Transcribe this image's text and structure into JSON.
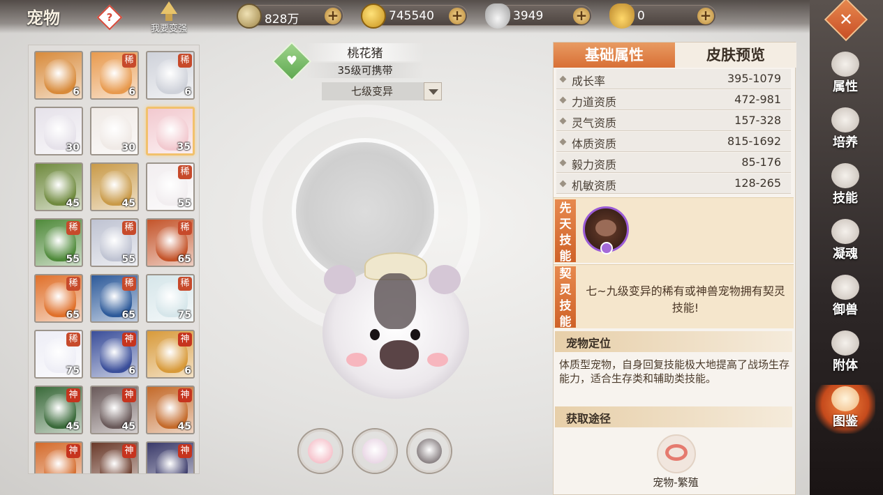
{
  "header": {
    "title": "宠物",
    "help_icon": "?",
    "stronger_label": "我要变强"
  },
  "currencies": [
    {
      "icon": "copper-coin-icon",
      "value": "828万"
    },
    {
      "icon": "gold-coin-icon",
      "value": "745540"
    },
    {
      "icon": "silver-ingot-icon",
      "value": "3949"
    },
    {
      "icon": "gold-ingot-icon",
      "value": "0"
    }
  ],
  "pet_grid": [
    {
      "color": "#d88a3a",
      "tag": "",
      "level": "6"
    },
    {
      "color": "#e89a4e",
      "tag": "稀",
      "level": "6"
    },
    {
      "color": "#cfd2da",
      "tag": "稀",
      "level": "6"
    },
    {
      "color": "#e6e2ea",
      "tag": "",
      "level": "30"
    },
    {
      "color": "#f0eae6",
      "tag": "",
      "level": "30"
    },
    {
      "color": "#f2c9cf",
      "tag": "",
      "level": "35",
      "selected": true
    },
    {
      "color": "#6f8a3e",
      "tag": "",
      "level": "45"
    },
    {
      "color": "#c99a48",
      "tag": "",
      "level": "45"
    },
    {
      "color": "#f2eef0",
      "tag": "稀",
      "level": "55"
    },
    {
      "color": "#4f8a3a",
      "tag": "稀",
      "level": "55"
    },
    {
      "color": "#bfc3d2",
      "tag": "稀",
      "level": "55"
    },
    {
      "color": "#c4542a",
      "tag": "稀",
      "level": "65"
    },
    {
      "color": "#e0702a",
      "tag": "稀",
      "level": "65"
    },
    {
      "color": "#2d5a9a",
      "tag": "稀",
      "level": "65"
    },
    {
      "color": "#d6e6ea",
      "tag": "稀",
      "level": "75"
    },
    {
      "color": "#eeeef6",
      "tag": "稀",
      "level": "75"
    },
    {
      "color": "#3a4e9a",
      "tag": "神",
      "level": "6"
    },
    {
      "color": "#d89a3a",
      "tag": "神",
      "level": "6"
    },
    {
      "color": "#3a6a3a",
      "tag": "神",
      "level": "45"
    },
    {
      "color": "#6a5a5a",
      "tag": "神",
      "level": "45"
    },
    {
      "color": "#c46a2a",
      "tag": "神",
      "level": "45"
    },
    {
      "color": "#d46a2a",
      "tag": "神",
      "level": ""
    },
    {
      "color": "#6a3a2a",
      "tag": "神",
      "level": ""
    },
    {
      "color": "#3a3a6a",
      "tag": "神",
      "level": ""
    }
  ],
  "pet": {
    "name": "桃花猪",
    "carry": "35级可携带",
    "mutation": "七级变异"
  },
  "skins": [
    {
      "color": "#f6c3cc"
    },
    {
      "color": "#ead8e6"
    },
    {
      "color": "#8a8284"
    }
  ],
  "tabs": {
    "basic": "基础属性",
    "skin_preview": "皮肤预览"
  },
  "attributes": [
    {
      "name": "成长率",
      "value": "395-1079"
    },
    {
      "name": "力道资质",
      "value": "472-981"
    },
    {
      "name": "灵气资质",
      "value": "157-328"
    },
    {
      "name": "体质资质",
      "value": "815-1692"
    },
    {
      "name": "毅力资质",
      "value": "85-176"
    },
    {
      "name": "机敏资质",
      "value": "128-265"
    }
  ],
  "innate_skill_label": "先天技能",
  "contract_skill_label": "契灵技能",
  "contract_text": "七~九级变异的稀有或神兽宠物拥有契灵技能!",
  "positioning": {
    "title": "宠物定位",
    "text": "体质型宠物，自身回复技能极大地提高了战场生存能力，适合生存类和辅助类技能。"
  },
  "obtain": {
    "title": "获取途径",
    "source_label": "宠物-繁殖"
  },
  "side_menu": [
    {
      "label": "属性",
      "icon": "paw-icon"
    },
    {
      "label": "培养",
      "icon": "cultivate-icon"
    },
    {
      "label": "技能",
      "icon": "scroll-icon"
    },
    {
      "label": "凝魂",
      "icon": "soul-icon"
    },
    {
      "label": "御兽",
      "icon": "dragon-icon"
    },
    {
      "label": "附体",
      "icon": "possess-icon"
    },
    {
      "label": "图鉴",
      "icon": "book-icon",
      "active": true
    }
  ],
  "close_icon": "✕"
}
